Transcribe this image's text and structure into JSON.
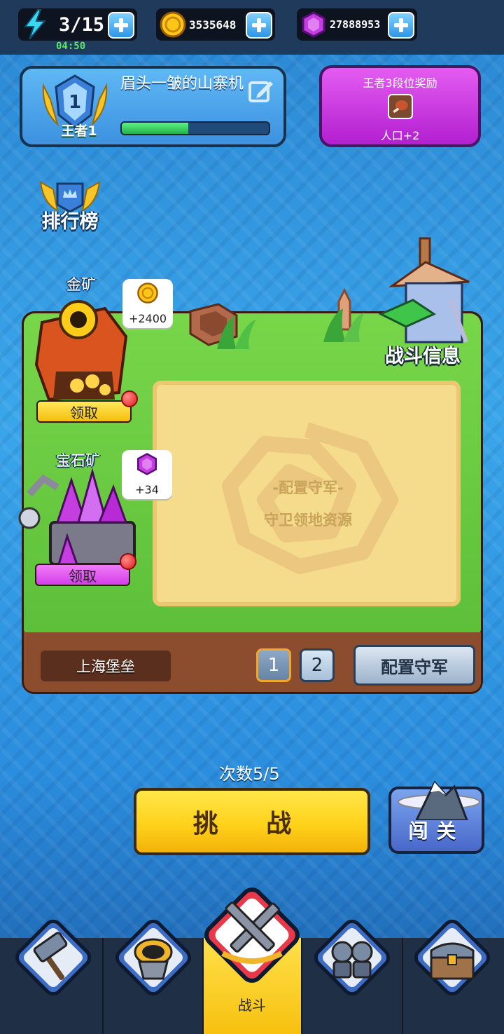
{
  "topbar": {
    "energy": "3/15",
    "energy_timer": "04:50",
    "gold": "3535648",
    "gems": "27888953"
  },
  "profile": {
    "rank_name": "王者1",
    "rank_number": "1",
    "player_name": "眉头一皱的山寨机",
    "progress_fraction": 0.45
  },
  "reward": {
    "title": "王者3段位奖励",
    "description": "人口+2"
  },
  "leaderboard": {
    "label": "排行榜"
  },
  "field": {
    "battle_info_label": "战斗信息",
    "placeholder_line1": "-配置守军-",
    "placeholder_line2": "守卫领地资源",
    "location_name": "上海堡垒",
    "pages": [
      "1",
      "2"
    ],
    "active_page": "1",
    "configure_button": "配置守军"
  },
  "mines": [
    {
      "name": "金矿",
      "yield": "+2400",
      "collect_label": "领取",
      "color": "#ffd21a"
    },
    {
      "name": "宝石矿",
      "yield": "+34",
      "collect_label": "领取",
      "color": "#d43ee8"
    }
  ],
  "actions": {
    "attempts": "次数5/5",
    "challenge_label": "挑 战",
    "stage_label": "闯关"
  },
  "nav": {
    "tabs": [
      {
        "icon": "hammer-icon",
        "label": ""
      },
      {
        "icon": "armor-icon",
        "label": ""
      },
      {
        "icon": "crossed-swords-icon",
        "label": "战斗"
      },
      {
        "icon": "soldiers-icon",
        "label": ""
      },
      {
        "icon": "treasure-chest-icon",
        "label": ""
      }
    ],
    "active_tab": 2
  }
}
